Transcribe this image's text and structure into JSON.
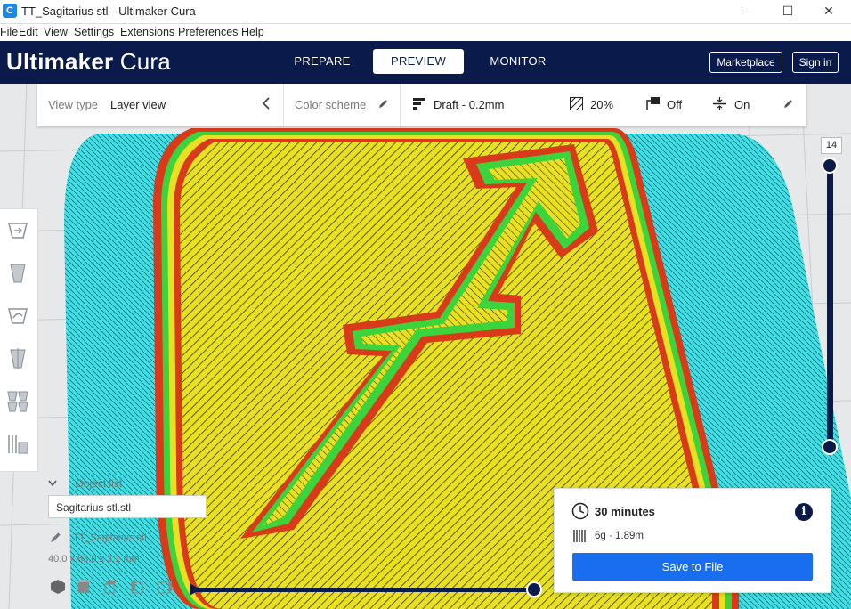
{
  "window": {
    "title": "TT_Sagitarius stl - Ultimaker Cura",
    "app_icon_glyph": "C",
    "controls": {
      "minimize": "—",
      "maximize": "☐",
      "close": "✕"
    }
  },
  "menu": [
    "File",
    "Edit",
    "View",
    "Settings",
    "Extensions",
    "Preferences",
    "Help"
  ],
  "header": {
    "logo_bold": "Ultimaker",
    "logo_thin": "Cura",
    "stages": [
      {
        "label": "PREPARE",
        "active": false
      },
      {
        "label": "PREVIEW",
        "active": true
      },
      {
        "label": "MONITOR",
        "active": false
      }
    ],
    "marketplace": "Marketplace",
    "signin": "Sign in"
  },
  "viewbar": {
    "view_type_label": "View type",
    "view_type_value": "Layer view",
    "color_scheme_label": "Color scheme",
    "profile": "Draft - 0.2mm",
    "infill": "20%",
    "support": "Off",
    "adhesion": "On"
  },
  "tools": [
    "move-tool-icon",
    "scale-tool-icon",
    "rotate-tool-icon",
    "mirror-tool-icon",
    "per-model-settings-icon",
    "support-blocker-icon"
  ],
  "layer_slider": {
    "current_layer": "14"
  },
  "object_list": {
    "header": "Object list",
    "input_value": "Sagitarius stl.stl",
    "object_name": "TT_Sagitarius stl",
    "dimensions": "40.0 x 63.0 x 3.1 mm"
  },
  "print_info": {
    "time": "30 minutes",
    "material": "6g · 1.89m",
    "save_label": "Save to File",
    "info_glyph": "i"
  },
  "colors": {
    "header_bg": "#0a1a4a",
    "accent_blue": "#196ef0",
    "skirt": "#3fe0e6",
    "infill": "#e8e020",
    "wall_outer": "#d83a1a",
    "wall_inner": "#3cd43c"
  }
}
